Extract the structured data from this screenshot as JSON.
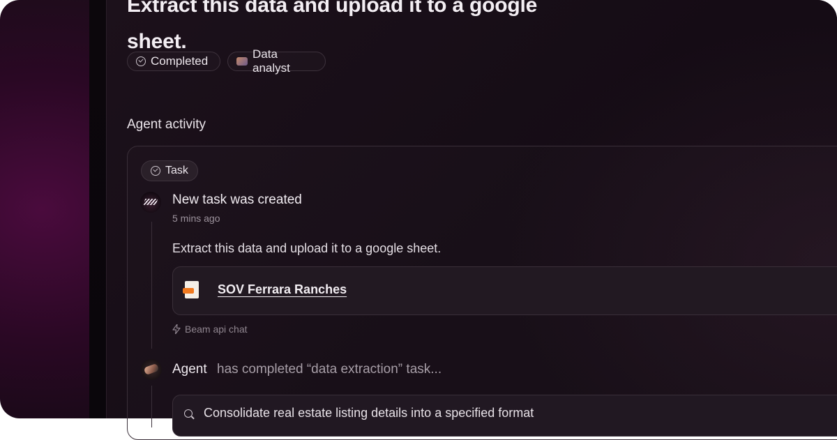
{
  "task": {
    "title": "Extract this data and upload it to a google sheet.",
    "status_chip": "Completed",
    "agent_chip": "Data analyst"
  },
  "activity": {
    "section_title": "Agent activity",
    "task_chip": "Task",
    "events": [
      {
        "title": "New task was created",
        "time": "5 mins ago",
        "description": "Extract this data and upload it to a google sheet.",
        "attachment": "SOV Ferrara Ranches",
        "source": "Beam api chat"
      }
    ],
    "agent_update": {
      "agent": "Agent",
      "status": "has completed “data extraction” task...",
      "step": "Consolidate real estate listing details into a specified format"
    }
  },
  "icons": {
    "status": "check-circle-icon",
    "agent_avatar": "data-analyst-icon",
    "attachment": "pdf-file-icon",
    "source": "bolt-icon",
    "search": "search-icon"
  },
  "colors": {
    "background": "#150c15",
    "sidebar_glow": "#4a0b3d",
    "pdf_accent": "#f0791f",
    "text": "#f3eef3"
  }
}
